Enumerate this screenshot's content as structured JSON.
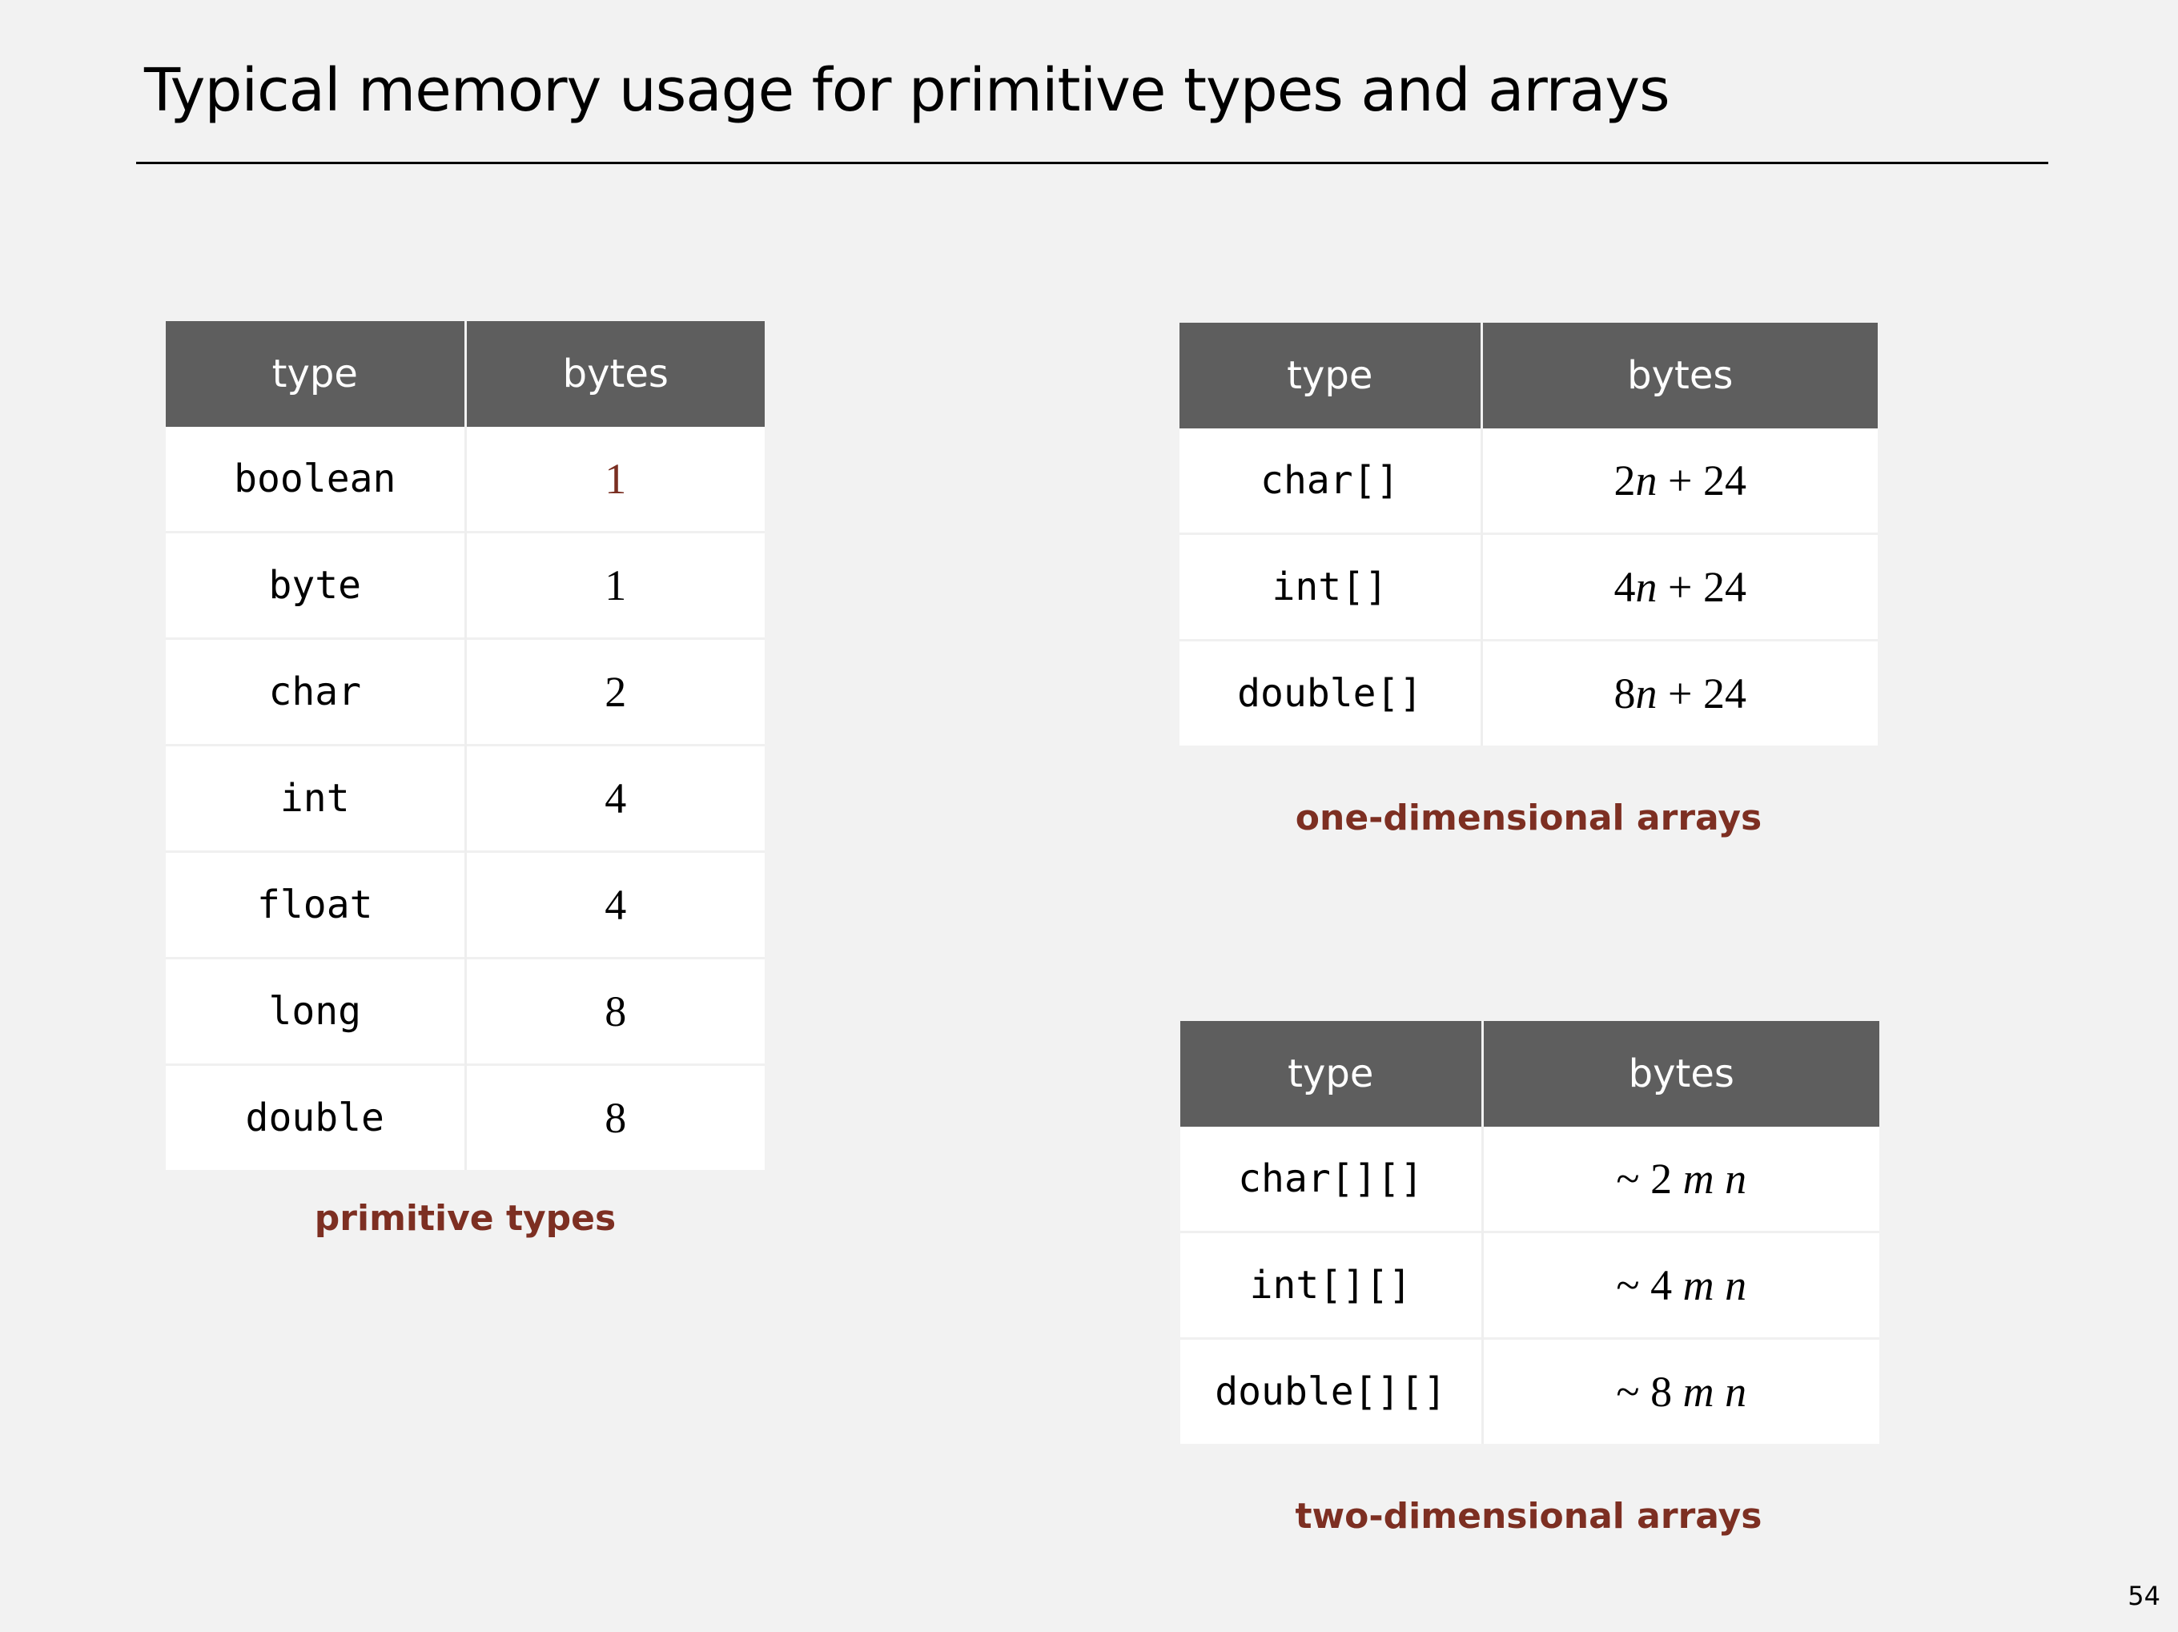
{
  "slide": {
    "title": "Typical memory usage for primitive types and arrays",
    "page_number": "54"
  },
  "primitive_table": {
    "headers": [
      "type",
      "bytes"
    ],
    "rows": [
      {
        "type": "boolean",
        "bytes": "1"
      },
      {
        "type": "byte",
        "bytes": "1"
      },
      {
        "type": "char",
        "bytes": "2"
      },
      {
        "type": "int",
        "bytes": "4"
      },
      {
        "type": "float",
        "bytes": "4"
      },
      {
        "type": "long",
        "bytes": "8"
      },
      {
        "type": "double",
        "bytes": "8"
      }
    ],
    "caption": "primitive types"
  },
  "one_dim_table": {
    "headers": [
      "type",
      "bytes"
    ],
    "rows": [
      {
        "type": "char[]",
        "bytes": "2n + 24"
      },
      {
        "type": "int[]",
        "bytes": "4n + 24"
      },
      {
        "type": "double[]",
        "bytes": "8n + 24"
      }
    ],
    "caption": "one-dimensional arrays"
  },
  "two_dim_table": {
    "headers": [
      "type",
      "bytes"
    ],
    "rows": [
      {
        "type": "char[][]",
        "bytes": "~ 2 m n"
      },
      {
        "type": "int[][]",
        "bytes": "~ 4 m n"
      },
      {
        "type": "double[][]",
        "bytes": "~ 8 m n"
      }
    ],
    "caption": "two-dimensional arrays"
  },
  "colors": {
    "header_bg": "#5e5e5e",
    "caption": "#7d2f22",
    "background": "#f2f2f2"
  }
}
